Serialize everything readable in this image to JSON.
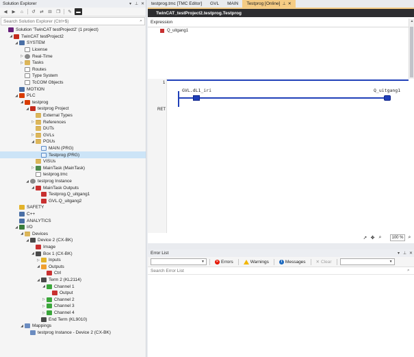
{
  "solution_explorer": {
    "title": "Solution Explorer",
    "search_placeholder": "Search Solution Explorer (Ctrl+$)",
    "tree": [
      {
        "label": "Solution 'TwinCAT testProject2' (1 project)",
        "indent": 0,
        "icon": "solution-icon",
        "twisty": ""
      },
      {
        "label": "TwinCAT testProject2",
        "indent": 1,
        "icon": "project-icon",
        "twisty": "◢"
      },
      {
        "label": "SYSTEM",
        "indent": 2,
        "icon": "system-icon",
        "twisty": "◢"
      },
      {
        "label": "License",
        "indent": 3,
        "icon": "file-icon",
        "twisty": ""
      },
      {
        "label": "Real-Time",
        "indent": 3,
        "icon": "gear-icon",
        "twisty": "▷"
      },
      {
        "label": "Tasks",
        "indent": 3,
        "icon": "folder-icon",
        "twisty": "▷"
      },
      {
        "label": "Routes",
        "indent": 3,
        "icon": "file-icon",
        "twisty": ""
      },
      {
        "label": "Type System",
        "indent": 3,
        "icon": "file-icon",
        "twisty": ""
      },
      {
        "label": "TcCOM Objects",
        "indent": 3,
        "icon": "file-icon",
        "twisty": ""
      },
      {
        "label": "MOTION",
        "indent": 2,
        "icon": "system-icon",
        "twisty": ""
      },
      {
        "label": "PLC",
        "indent": 2,
        "icon": "plc-icon",
        "twisty": "◢"
      },
      {
        "label": "testprog",
        "indent": 3,
        "icon": "plc-icon",
        "twisty": "◢"
      },
      {
        "label": "testprog Project",
        "indent": 4,
        "icon": "project-icon",
        "twisty": "◢"
      },
      {
        "label": "External Types",
        "indent": 5,
        "icon": "folder-icon",
        "twisty": ""
      },
      {
        "label": "References",
        "indent": 5,
        "icon": "folder-icon",
        "twisty": "▷"
      },
      {
        "label": "DUTs",
        "indent": 5,
        "icon": "folder-icon",
        "twisty": ""
      },
      {
        "label": "GVLs",
        "indent": 5,
        "icon": "folder-icon",
        "twisty": "▷"
      },
      {
        "label": "POUs",
        "indent": 5,
        "icon": "folder-icon",
        "twisty": "◢"
      },
      {
        "label": "MAIN (PRG)",
        "indent": 6,
        "icon": "pou-icon",
        "twisty": ""
      },
      {
        "label": "Testprog (PRG)",
        "indent": 6,
        "icon": "pou-icon",
        "twisty": "",
        "selected": true
      },
      {
        "label": "VISUs",
        "indent": 5,
        "icon": "folder-icon",
        "twisty": ""
      },
      {
        "label": "MainTask (MainTask)",
        "indent": 5,
        "icon": "task-icon",
        "twisty": "▷"
      },
      {
        "label": "testprog.tmc",
        "indent": 5,
        "icon": "file-icon",
        "twisty": ""
      },
      {
        "label": "testprog Instance",
        "indent": 4,
        "icon": "gear-icon",
        "twisty": "◢"
      },
      {
        "label": "MainTask Outputs",
        "indent": 5,
        "icon": "variable-icon",
        "twisty": "◢"
      },
      {
        "label": "Testprog.Q_uitgang1",
        "indent": 6,
        "icon": "variable-icon",
        "twisty": ""
      },
      {
        "label": "GVL.Q_uitgang2",
        "indent": 6,
        "icon": "variable-icon",
        "twisty": ""
      },
      {
        "label": "SAFETY",
        "indent": 2,
        "icon": "safety-icon",
        "twisty": ""
      },
      {
        "label": "C++",
        "indent": 2,
        "icon": "cpp-icon",
        "twisty": ""
      },
      {
        "label": "ANALYTICS",
        "indent": 2,
        "icon": "analytics-icon",
        "twisty": ""
      },
      {
        "label": "I/O",
        "indent": 2,
        "icon": "io-icon",
        "twisty": "◢"
      },
      {
        "label": "Devices",
        "indent": 3,
        "icon": "folder-icon",
        "twisty": "◢"
      },
      {
        "label": "Device 2 (CX-BK)",
        "indent": 4,
        "icon": "device-icon",
        "twisty": "◢"
      },
      {
        "label": "Image",
        "indent": 5,
        "icon": "variable-icon",
        "twisty": ""
      },
      {
        "label": "Box 1 (CX-BK)",
        "indent": 5,
        "icon": "device-icon",
        "twisty": "◢"
      },
      {
        "label": "Inputs",
        "indent": 6,
        "icon": "input-icon",
        "twisty": "▷"
      },
      {
        "label": "Outputs",
        "indent": 6,
        "icon": "output-icon",
        "twisty": "◢"
      },
      {
        "label": "Ctrl",
        "indent": 7,
        "icon": "variable-icon",
        "twisty": ""
      },
      {
        "label": "Term 2 (KL2114)",
        "indent": 6,
        "icon": "device-icon",
        "twisty": "◢"
      },
      {
        "label": "Channel 1",
        "indent": 7,
        "icon": "green-icon",
        "twisty": "◢"
      },
      {
        "label": "Output",
        "indent": 8,
        "icon": "variable-icon",
        "twisty": ""
      },
      {
        "label": "Channel 2",
        "indent": 7,
        "icon": "green-icon",
        "twisty": "▷"
      },
      {
        "label": "Channel 3",
        "indent": 7,
        "icon": "green-icon",
        "twisty": "▷"
      },
      {
        "label": "Channel 4",
        "indent": 7,
        "icon": "green-icon",
        "twisty": "▷"
      },
      {
        "label": "End Term (KL9010)",
        "indent": 6,
        "icon": "device-icon",
        "twisty": ""
      },
      {
        "label": "Mappings",
        "indent": 3,
        "icon": "mapping-icon",
        "twisty": "◢"
      },
      {
        "label": "testprog Instance - Device 2 (CX-BK)",
        "indent": 4,
        "icon": "mapping-icon",
        "twisty": ""
      }
    ]
  },
  "tabs": [
    {
      "label": "testprog.tmc [TMC Editor]",
      "active": false
    },
    {
      "label": "GVL",
      "active": false
    },
    {
      "label": "MAIN",
      "active": false
    },
    {
      "label": "Testprog [Online]",
      "active": true
    }
  ],
  "editor": {
    "title": "TwinCAT_testProject2.testprog.Testprog",
    "watch_header": "Expression",
    "watch_item": "Q_uitgang1",
    "network_number": "1",
    "contact_variable": "GVL.dL1_iri",
    "coil_variable": "Q_uitgang1",
    "ret_label": "RET",
    "zoom": "100 %"
  },
  "error_list": {
    "title": "Error List",
    "errors_label": "Errors",
    "warnings_label": "Warnings",
    "messages_label": "Messages",
    "clear_label": "Clear",
    "search_placeholder": "Search Error List"
  }
}
